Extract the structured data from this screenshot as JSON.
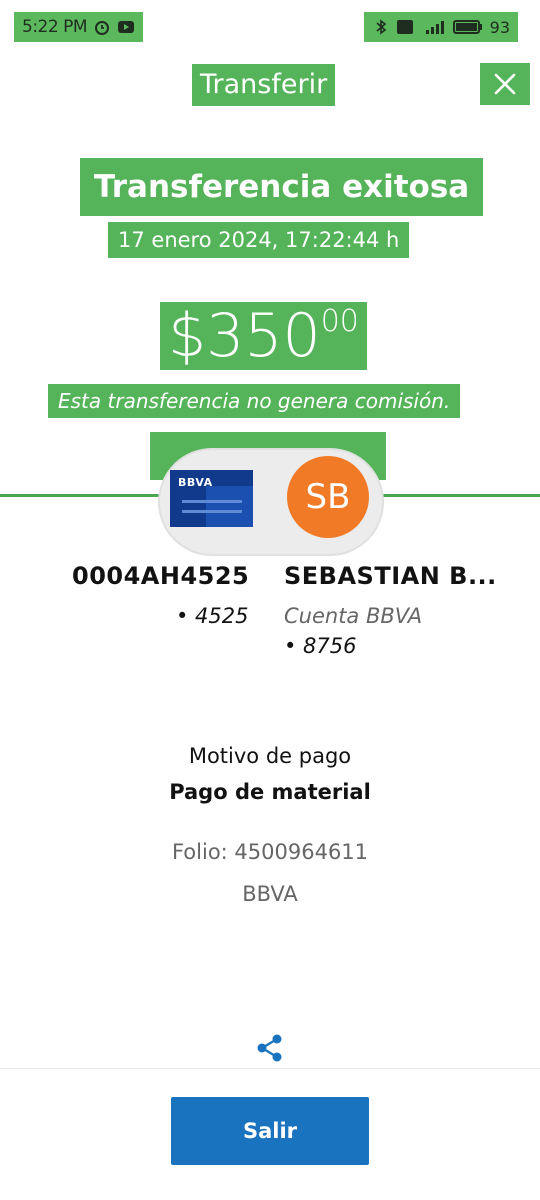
{
  "status_bar": {
    "time": "5:22 PM",
    "battery": "93"
  },
  "header": {
    "title": "Transferir",
    "close_icon": "close-icon"
  },
  "result": {
    "headline": "Transferencia exitosa",
    "datetime": "17 enero 2024, 17:22:44 h",
    "amount_main": "$350",
    "amount_cents": "00",
    "commission_note": "Esta transferencia no genera comisión."
  },
  "parties": {
    "card_logo": "BBVA",
    "initials": "SB",
    "source_account": "0004AH4525",
    "source_digits": "• 4525",
    "destination_name": "SEBASTIAN B...",
    "destination_bank": "Cuenta BBVA",
    "destination_digits": "• 8756"
  },
  "details": {
    "motivo_label": "Motivo de pago",
    "motivo_value": "Pago de material",
    "folio": "Folio: 4500964611",
    "bank": "BBVA"
  },
  "actions": {
    "share_icon": "share-icon",
    "exit_label": "Salir"
  },
  "colors": {
    "highlight_green": "#55b45a",
    "primary_blue": "#1a73be",
    "avatar_orange": "#f07a26"
  }
}
